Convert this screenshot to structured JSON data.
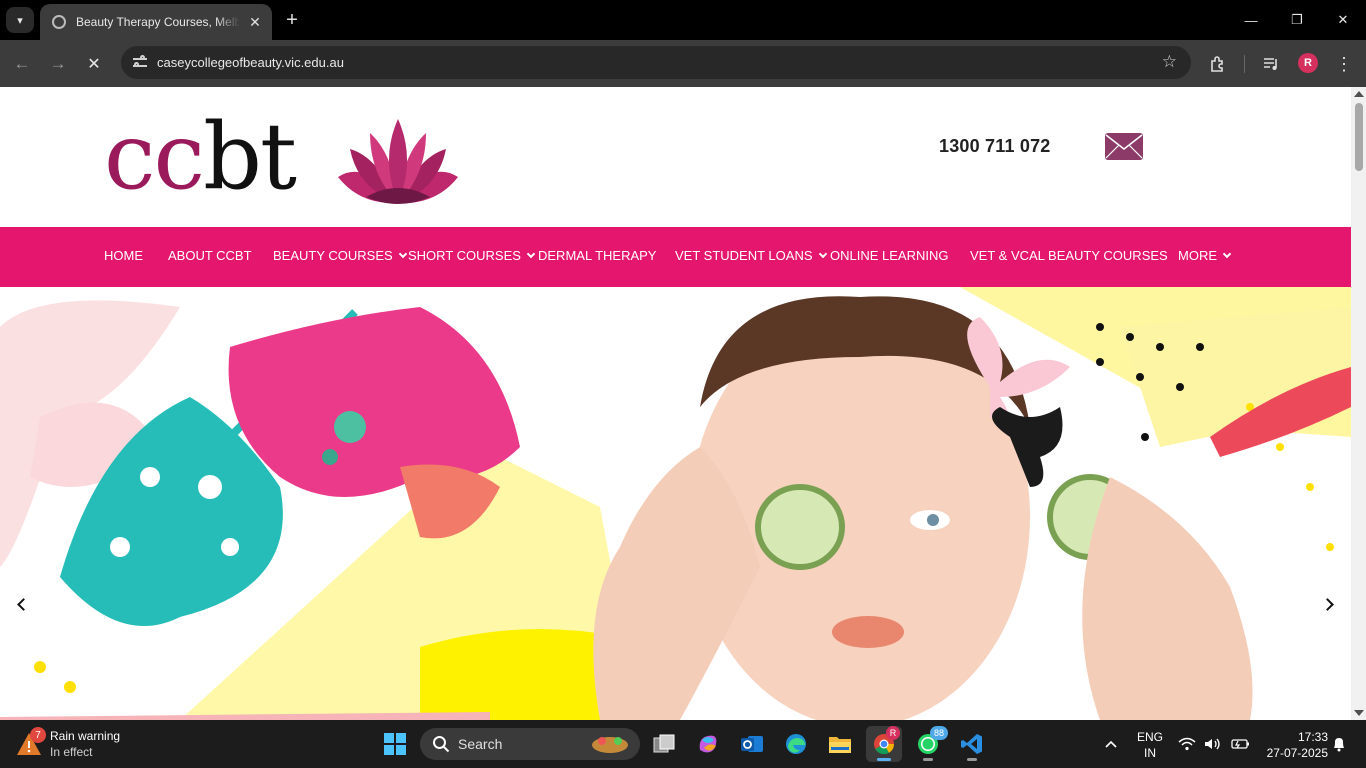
{
  "browser": {
    "tab_title": "Beauty Therapy Courses, Melbourne",
    "url": "caseycollegeofbeauty.vic.edu.au",
    "profile_initial": "R",
    "new_tab_symbol": "+",
    "tab_close_symbol": "✕",
    "window_controls": {
      "minimize": "—",
      "maximize": "❐",
      "close": "✕"
    },
    "icons": [
      "tab-search-icon",
      "back-icon",
      "forward-icon",
      "stop-loading-icon",
      "site-settings-icon",
      "bookmark-star-icon",
      "extensions-icon",
      "media-controls-icon",
      "menu-icon"
    ]
  },
  "site": {
    "logo_text_cc": "cc",
    "logo_text_bt": "bt",
    "phone": "1300 711 072",
    "nav": [
      {
        "label": "HOME",
        "dropdown": false
      },
      {
        "label": "ABOUT CCBT",
        "dropdown": false
      },
      {
        "label": "BEAUTY COURSES",
        "dropdown": true
      },
      {
        "label": "SHORT COURSES",
        "dropdown": true
      },
      {
        "label": "DERMAL THERAPY",
        "dropdown": false
      },
      {
        "label": "VET STUDENT LOANS",
        "dropdown": true
      },
      {
        "label": "ONLINE LEARNING",
        "dropdown": false
      },
      {
        "label": "VET & VCAL BEAUTY COURSES",
        "dropdown": false
      },
      {
        "label": "MORE",
        "dropdown": true
      }
    ],
    "colors": {
      "nav_pink": "#e5166d",
      "logo_plum": "#9a1a5c",
      "mail_icon": "#8c3a68"
    }
  },
  "taskbar": {
    "weather_badge": "7",
    "weather_title": "Rain warning",
    "weather_sub": "In effect",
    "search_label": "Search",
    "chrome_badge": "R",
    "whatsapp_badge": "88",
    "lang_1": "ENG",
    "lang_2": "IN",
    "time": "17:33",
    "date": "27-07-2025"
  }
}
